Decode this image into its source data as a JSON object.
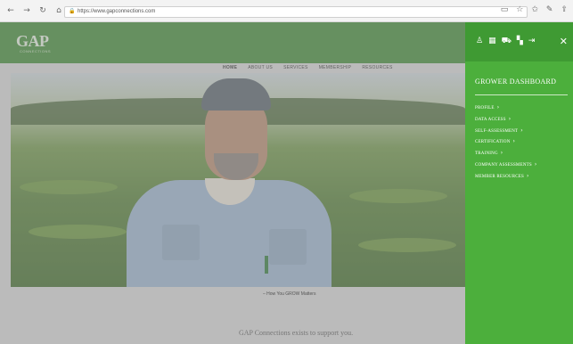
{
  "browser": {
    "url": "https://www.gapconnections.com",
    "nav_icons": [
      "back-icon",
      "forward-icon",
      "reload-icon",
      "home-icon"
    ],
    "toolbar_icons": [
      "reader-icon",
      "favorite-icon",
      "collections-icon",
      "pen-icon",
      "share-icon"
    ]
  },
  "site": {
    "logo": "GAP",
    "logo_sub": "CONNECTIONS",
    "nav": [
      "HOME",
      "ABOUT US",
      "SERVICES",
      "MEMBERSHIP",
      "RESOURCES"
    ],
    "video_caption": "– How You GROW Matters",
    "support_text": "GAP Connections exists to support you."
  },
  "dashboard": {
    "icons": [
      "user-icon",
      "calendar-icon",
      "cart-icon",
      "dashboard-icon",
      "logout-icon"
    ],
    "title": "GROWER DASHBOARD",
    "menu": [
      {
        "label": "PROFILE"
      },
      {
        "label": "DATA ACCESS"
      },
      {
        "label": "SELF-ASSESSMENT"
      },
      {
        "label": "CERTIFICATION"
      },
      {
        "label": "TRAINING"
      },
      {
        "label": "COMPANY ASSESSMENTS"
      },
      {
        "label": "MEMBER RESOURCES"
      }
    ],
    "colors": {
      "panel": "#4caf3c",
      "header": "#3f8a34"
    }
  }
}
